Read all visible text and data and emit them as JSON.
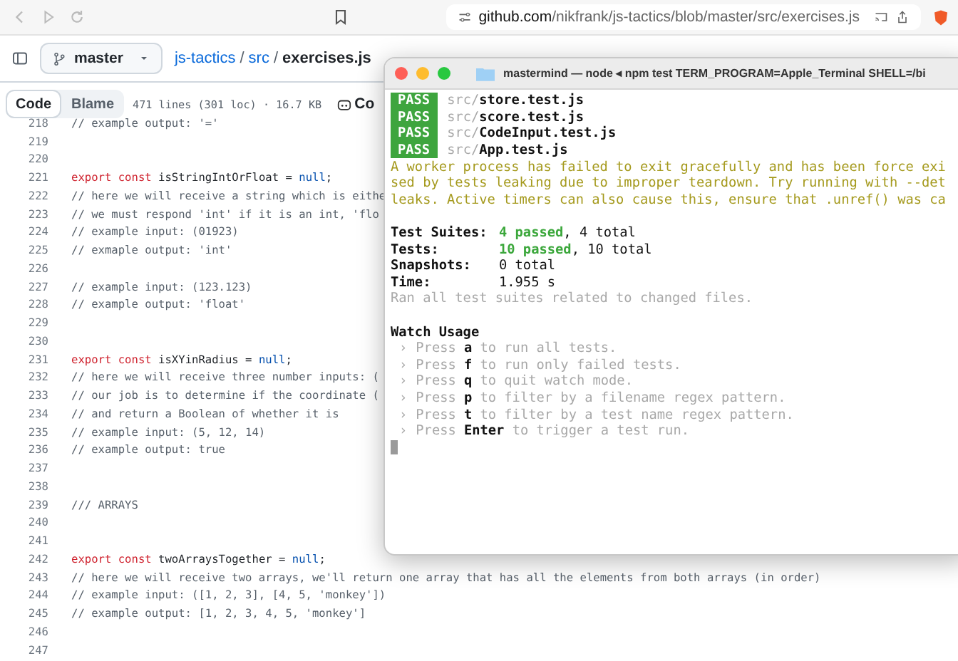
{
  "browser": {
    "url_host": "github.com",
    "url_path": "/nikfrank/js-tactics/blob/master/src/exercises.js"
  },
  "repo_header": {
    "branch": "master",
    "breadcrumb": [
      {
        "text": "js-tactics",
        "kind": "link"
      },
      {
        "text": "/",
        "kind": "separator"
      },
      {
        "text": "src",
        "kind": "link"
      },
      {
        "text": "/",
        "kind": "separator"
      },
      {
        "text": "exercises.js",
        "kind": "current"
      }
    ]
  },
  "file_toolbar": {
    "tabs": [
      {
        "label": "Code",
        "selected": true
      },
      {
        "label": "Blame",
        "selected": false
      }
    ],
    "info": "471 lines (301 loc) · 16.7 KB",
    "copilot_label": "Co"
  },
  "code_lines": [
    {
      "number": "218",
      "segments": [
        {
          "kind": "comment",
          "text": "// example output: '='"
        }
      ]
    },
    {
      "number": "219"
    },
    {
      "number": "220"
    },
    {
      "number": "221",
      "segments": [
        {
          "kind": "keyword",
          "text": "export const"
        },
        {
          "kind": "plain",
          "text": " isStringIntOrFloat = "
        },
        {
          "kind": "literal",
          "text": "null"
        },
        {
          "kind": "plain",
          "text": ";"
        }
      ]
    },
    {
      "number": "222",
      "segments": [
        {
          "kind": "comment",
          "text": "// here we will receive a string which is eithe"
        }
      ]
    },
    {
      "number": "223",
      "segments": [
        {
          "kind": "comment",
          "text": "// we must respond 'int' if it is an int, 'flo"
        }
      ]
    },
    {
      "number": "224",
      "segments": [
        {
          "kind": "comment",
          "text": "// example input: (01923)"
        }
      ]
    },
    {
      "number": "225",
      "segments": [
        {
          "kind": "comment",
          "text": "// exmaple output: 'int'"
        }
      ]
    },
    {
      "number": "226"
    },
    {
      "number": "227",
      "segments": [
        {
          "kind": "comment",
          "text": "// example input: (123.123)"
        }
      ]
    },
    {
      "number": "228",
      "segments": [
        {
          "kind": "comment",
          "text": "// example output: 'float'"
        }
      ]
    },
    {
      "number": "229"
    },
    {
      "number": "230"
    },
    {
      "number": "231",
      "segments": [
        {
          "kind": "keyword",
          "text": "export const"
        },
        {
          "kind": "plain",
          "text": " isXYinRadius = "
        },
        {
          "kind": "literal",
          "text": "null"
        },
        {
          "kind": "plain",
          "text": ";"
        }
      ]
    },
    {
      "number": "232",
      "segments": [
        {
          "kind": "comment",
          "text": "// here we will receive three number inputs: ("
        }
      ]
    },
    {
      "number": "233",
      "segments": [
        {
          "kind": "comment",
          "text": "// our job is to determine if the coordinate ("
        }
      ]
    },
    {
      "number": "234",
      "segments": [
        {
          "kind": "comment",
          "text": "// and return a Boolean of whether it is"
        }
      ]
    },
    {
      "number": "235",
      "segments": [
        {
          "kind": "comment",
          "text": "// example input: (5, 12, 14)"
        }
      ]
    },
    {
      "number": "236",
      "segments": [
        {
          "kind": "comment",
          "text": "// example output: true"
        }
      ]
    },
    {
      "number": "237"
    },
    {
      "number": "238"
    },
    {
      "number": "239",
      "segments": [
        {
          "kind": "comment",
          "text": "/// ARRAYS"
        }
      ]
    },
    {
      "number": "240"
    },
    {
      "number": "241"
    },
    {
      "number": "242",
      "segments": [
        {
          "kind": "keyword",
          "text": "export const"
        },
        {
          "kind": "plain",
          "text": " twoArraysTogether = "
        },
        {
          "kind": "literal",
          "text": "null"
        },
        {
          "kind": "plain",
          "text": ";"
        }
      ]
    },
    {
      "number": "243",
      "segments": [
        {
          "kind": "comment",
          "text": "// here we will receive two arrays, we'll return one array that has all the elements from both arrays (in order)"
        }
      ]
    },
    {
      "number": "244",
      "segments": [
        {
          "kind": "comment",
          "text": "// example input: ([1, 2, 3], [4, 5, 'monkey'])"
        }
      ]
    },
    {
      "number": "245",
      "segments": [
        {
          "kind": "comment",
          "text": "// example output: [1, 2, 3, 4, 5, 'monkey']"
        }
      ]
    },
    {
      "number": "246"
    },
    {
      "number": "247"
    }
  ],
  "terminal": {
    "title": "mastermind — node ◂ npm test TERM_PROGRAM=Apple_Terminal SHELL=/bi",
    "lines": [
      {
        "kind": "pass",
        "badge": "PASS",
        "dir": "src/",
        "file": "store.test.js"
      },
      {
        "kind": "pass",
        "badge": "PASS",
        "dir": "src/",
        "file": "score.test.js"
      },
      {
        "kind": "pass",
        "badge": "PASS",
        "dir": "src/",
        "file": "CodeInput.test.js"
      },
      {
        "kind": "pass",
        "badge": "PASS",
        "dir": "src/",
        "file": "App.test.js"
      },
      {
        "kind": "text",
        "segments": [
          {
            "kind": "warning",
            "text": "A worker process has failed to exit gracefully and has been force exi"
          }
        ]
      },
      {
        "kind": "text",
        "segments": [
          {
            "kind": "warning",
            "text": "sed by tests leaking due to improper teardown. Try running with --det"
          }
        ]
      },
      {
        "kind": "text",
        "segments": [
          {
            "kind": "warning",
            "text": "leaks. Active timers can also cause this, ensure that .unref() was ca"
          }
        ]
      },
      {
        "kind": "blank"
      },
      {
        "kind": "summary",
        "label": "Test Suites:",
        "segments": [
          {
            "kind": "success",
            "text": "4 passed"
          },
          {
            "kind": "plain",
            "text": ", 4 total"
          }
        ]
      },
      {
        "kind": "summary",
        "label": "Tests:",
        "segments": [
          {
            "kind": "success",
            "text": "10 passed"
          },
          {
            "kind": "plain",
            "text": ", 10 total"
          }
        ]
      },
      {
        "kind": "summary",
        "label": "Snapshots:",
        "segments": [
          {
            "kind": "plain",
            "text": "0 total"
          }
        ]
      },
      {
        "kind": "summary",
        "label": "Time:",
        "segments": [
          {
            "kind": "plain",
            "text": "1.955 s"
          }
        ]
      },
      {
        "kind": "text",
        "segments": [
          {
            "kind": "muted",
            "text": "Ran all test suites related to changed files."
          }
        ]
      },
      {
        "kind": "blank"
      },
      {
        "kind": "text",
        "segments": [
          {
            "kind": "bold",
            "text": "Watch Usage"
          }
        ]
      },
      {
        "kind": "hint",
        "marker": "›",
        "press": "Press",
        "key": "a",
        "rest": "to run all tests."
      },
      {
        "kind": "hint",
        "marker": "›",
        "press": "Press",
        "key": "f",
        "rest": "to run only failed tests."
      },
      {
        "kind": "hint",
        "marker": "›",
        "press": "Press",
        "key": "q",
        "rest": "to quit watch mode."
      },
      {
        "kind": "hint",
        "marker": "›",
        "press": "Press",
        "key": "p",
        "rest": "to filter by a filename regex pattern."
      },
      {
        "kind": "hint",
        "marker": "›",
        "press": "Press",
        "key": "t",
        "rest": "to filter by a test name regex pattern."
      },
      {
        "kind": "hint",
        "marker": "›",
        "press": "Press",
        "key": "Enter",
        "rest": "to trigger a test run."
      },
      {
        "kind": "cursor"
      }
    ]
  }
}
